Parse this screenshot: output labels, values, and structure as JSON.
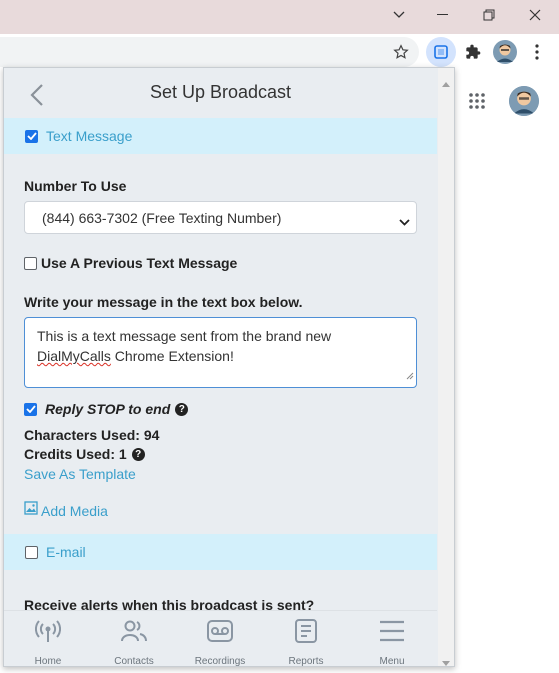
{
  "popup": {
    "title": "Set Up Broadcast",
    "text_message_section": {
      "label": "Text Message",
      "checked": true
    },
    "number_label": "Number To Use",
    "number_value": "(844) 663-7302 (Free Texting Number)",
    "previous_message": {
      "label": "Use A Previous Text Message",
      "checked": false
    },
    "message_instruction": "Write your message in the text box below.",
    "message_prefix": "This is a text message sent from the brand new ",
    "message_brand": "DialMyCalls",
    "message_suffix": " Chrome Extension!",
    "reply_stop": {
      "label": "Reply STOP to end",
      "checked": true,
      "help_icon": "?"
    },
    "characters_used": "Characters Used: 94",
    "credits_used": "Credits Used: 1",
    "credits_help_icon": "?",
    "save_template": "Save As Template",
    "add_media": "Add Media",
    "email_section": {
      "label": "E-mail",
      "checked": false
    },
    "alerts_label": "Receive alerts when this broadcast is sent?"
  },
  "bottom_nav": [
    {
      "label": "Home",
      "icon": "broadcast-icon"
    },
    {
      "label": "Contacts",
      "icon": "contacts-icon"
    },
    {
      "label": "Recordings",
      "icon": "voicemail-icon"
    },
    {
      "label": "Reports",
      "icon": "reports-icon"
    },
    {
      "label": "Menu",
      "icon": "hamburger-icon"
    }
  ],
  "colors": {
    "accent": "#3a9fcb",
    "section_bar": "#d3f0fb",
    "titlebar": "#e8dadb"
  }
}
